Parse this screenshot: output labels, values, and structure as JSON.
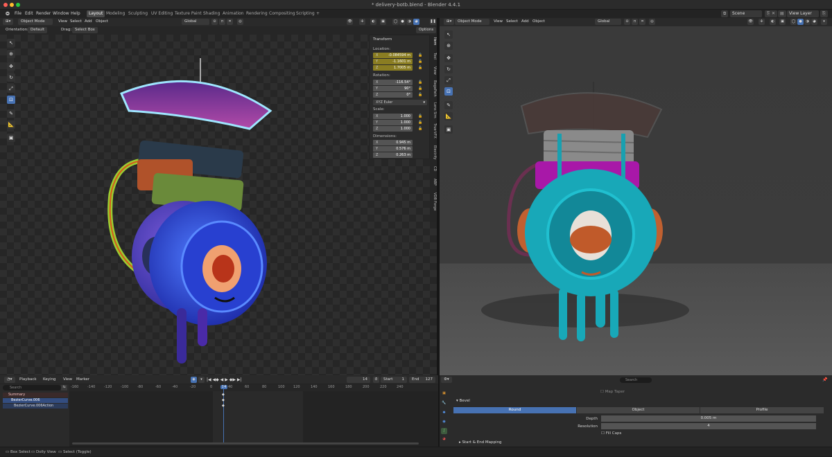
{
  "window": {
    "title": "* delivery-botb.blend - Blender 4.4.1"
  },
  "menu": {
    "file": "File",
    "edit": "Edit",
    "render": "Render",
    "window": "Window",
    "help": "Help"
  },
  "workspaces": [
    "Layout",
    "Modeling",
    "Sculpting",
    "UV Editing",
    "Texture Paint",
    "Shading",
    "Animation",
    "Rendering",
    "Compositing",
    "Scripting"
  ],
  "workspace_add": "+",
  "scene": {
    "name": "Scene",
    "view_layer": "View Layer"
  },
  "viewport_left": {
    "mode": "Object Mode",
    "menus": [
      "View",
      "Select",
      "Add",
      "Object"
    ],
    "orientation_label": "Orientation:",
    "orientation": "Default",
    "drag_label": "Drag:",
    "drag": "Select Box",
    "transform_orientation": "Global",
    "options": "Options"
  },
  "viewport_right": {
    "mode": "Object Mode",
    "menus": [
      "View",
      "Select",
      "Add",
      "Object"
    ],
    "transform_orientation": "Global"
  },
  "npanel": {
    "section": "Transform",
    "location_label": "Location:",
    "location": [
      {
        "ax": "X",
        "v": "-0.084594 m"
      },
      {
        "ax": "Y",
        "v": "-1.1601 m"
      },
      {
        "ax": "Z",
        "v": "1.7005 m"
      }
    ],
    "rotation_label": "Rotation:",
    "rotation": [
      {
        "ax": "X",
        "v": "-116.54°"
      },
      {
        "ax": "Y",
        "v": "90°"
      },
      {
        "ax": "Z",
        "v": "0°"
      }
    ],
    "rotation_mode": "XYZ Euler",
    "scale_label": "Scale:",
    "scale": [
      {
        "ax": "X",
        "v": "1.000"
      },
      {
        "ax": "Y",
        "v": "1.000"
      },
      {
        "ax": "Z",
        "v": "1.000"
      }
    ],
    "dimensions_label": "Dimensions:",
    "dimensions": [
      {
        "ax": "X",
        "v": "0.945 m"
      },
      {
        "ax": "Y",
        "v": "0.576 m"
      },
      {
        "ax": "Z",
        "v": "0.263 m"
      }
    ],
    "tabs": [
      "Item",
      "Tool",
      "View",
      "BagaPath",
      "Lens Sim",
      "True-VFX",
      "Electrify",
      "CD",
      "ABP",
      "VDB Forge"
    ]
  },
  "timeline": {
    "menus": [
      "Playback",
      "Keying",
      "View",
      "Marker"
    ],
    "current_frame": "14",
    "start_label": "Start",
    "start": "1",
    "end_label": "End",
    "end": "127",
    "ruler": [
      "-160",
      "-140",
      "-120",
      "-100",
      "-80",
      "-60",
      "-40",
      "-20",
      "0",
      "14",
      "40",
      "60",
      "80",
      "100",
      "120",
      "140",
      "160",
      "180",
      "200",
      "220",
      "240"
    ],
    "search_placeholder": "Search",
    "tracks": [
      "Summary",
      "BezierCurve.006",
      "BezierCurve.006Action"
    ]
  },
  "properties": {
    "search_placeholder": "Search",
    "map_taper": "Map Taper",
    "bevel_section": "Bevel",
    "bevel_modes": [
      "Round",
      "Object",
      "Profile"
    ],
    "depth_label": "Depth",
    "depth": "0.005 m",
    "resolution_label": "Resolution",
    "resolution": "4",
    "fill_caps": "Fill Caps",
    "start_end_mapping": "Start & End Mapping"
  },
  "status": {
    "left": "Box Select",
    "middle": "Dolly View",
    "right": "Select (Toggle)"
  },
  "colors": {
    "accent": "#4772b3",
    "highlight_field": "#8a7d22",
    "selected_row": "#334d80"
  }
}
